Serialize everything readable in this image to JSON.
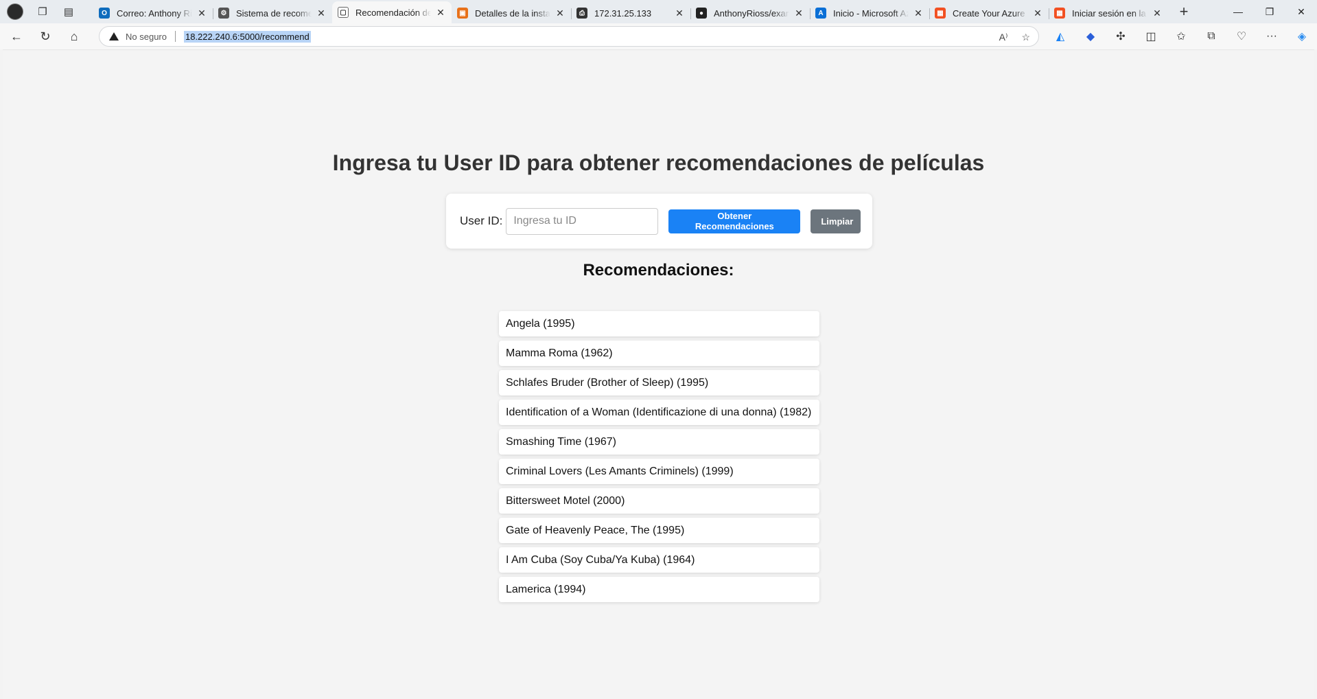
{
  "browser": {
    "tabs": [
      {
        "title": "Correo: Anthony Rios",
        "favicon_color": "#0f6cbd",
        "favicon_glyph": "O"
      },
      {
        "title": "Sistema de recomendación",
        "favicon_color": "#555555",
        "favicon_glyph": "⚙"
      },
      {
        "title": "Recomendación de Películas",
        "favicon_color": "#ffffff",
        "favicon_glyph": "▢"
      },
      {
        "title": "Detalles de la instancia",
        "favicon_color": "#e8711a",
        "favicon_glyph": "▣"
      },
      {
        "title": "172.31.25.133",
        "favicon_color": "#333333",
        "favicon_glyph": "⎙"
      },
      {
        "title": "AnthonyRioss/examen",
        "favicon_color": "#222222",
        "favicon_glyph": "●"
      },
      {
        "title": "Inicio - Microsoft Azure",
        "favicon_color": "#0a6fd6",
        "favicon_glyph": "A"
      },
      {
        "title": "Create Your Azure Free",
        "favicon_color": "#f25022",
        "favicon_glyph": "▦"
      },
      {
        "title": "Iniciar sesión en la cuenta",
        "favicon_color": "#f25022",
        "favicon_glyph": "▦"
      }
    ],
    "active_tab_index": 2,
    "address": {
      "security_label": "No seguro",
      "url": "18.222.240.6:5000/recommend"
    }
  },
  "page": {
    "heading": "Ingresa tu User ID para obtener recomendaciones de películas",
    "form": {
      "label": "User ID:",
      "input_placeholder": "Ingresa tu ID",
      "input_value": "",
      "submit_label": "Obtener Recomendaciones",
      "clear_label": "Limpiar"
    },
    "results_title": "Recomendaciones:",
    "recommendations": [
      "Angela (1995)",
      "Mamma Roma (1962)",
      "Schlafes Bruder (Brother of Sleep) (1995)",
      "Identification of a Woman (Identificazione di una donna) (1982)",
      "Smashing Time (1967)",
      "Criminal Lovers (Les Amants Criminels) (1999)",
      "Bittersweet Motel (2000)",
      "Gate of Heavenly Peace, The (1995)",
      "I Am Cuba (Soy Cuba/Ya Kuba) (1964)",
      "Lamerica (1994)"
    ]
  },
  "colors": {
    "primary_button": "#1a82f5",
    "secondary_button": "#6c757d"
  }
}
